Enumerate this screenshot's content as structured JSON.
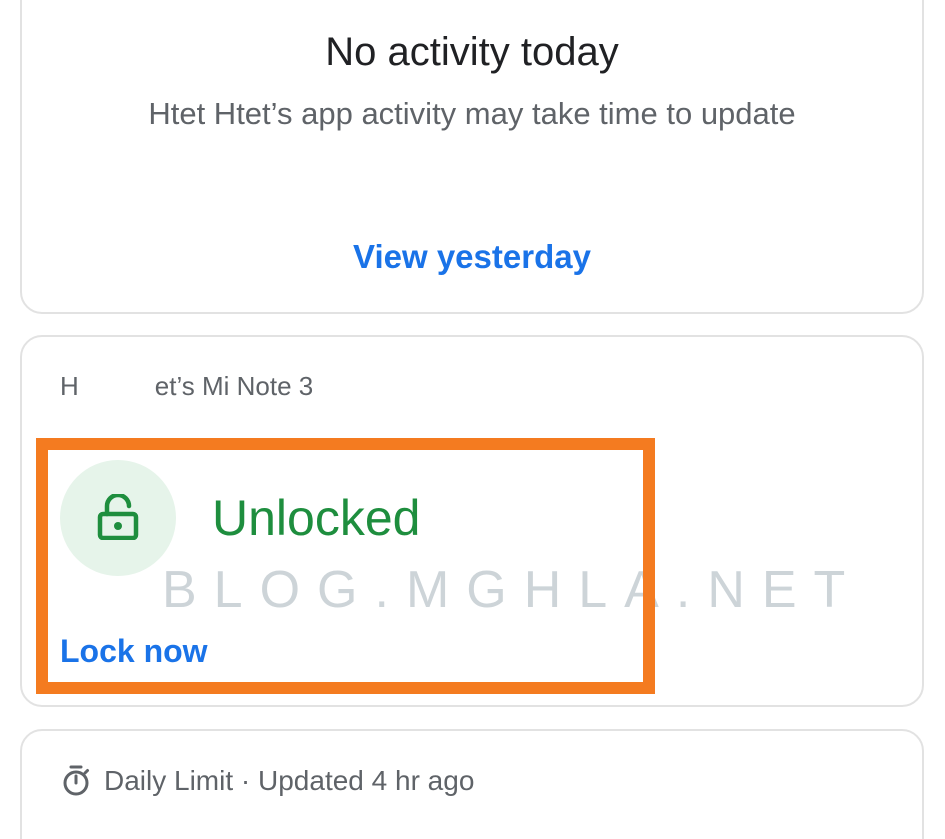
{
  "activity_card": {
    "title": "No activity today",
    "subtitle": "Htet Htet’s app activity may take time to update",
    "link": "View yesterday"
  },
  "device_card": {
    "device_name_prefix": "H",
    "device_name_suffix": "et’s Mi Note 3",
    "lock_icon": "unlocked-padlock-icon",
    "status": "Unlocked",
    "action": "Lock now",
    "watermark": "BLOG.MGHLA.NET"
  },
  "limit_card": {
    "icon": "stopwatch-icon",
    "label": "Daily Limit · Updated 4 hr ago"
  },
  "colors": {
    "link_blue": "#1a73e8",
    "unlocked_green": "#1e8e3e",
    "circle_bg": "#e6f4ea",
    "highlight_orange": "#f47b20"
  }
}
